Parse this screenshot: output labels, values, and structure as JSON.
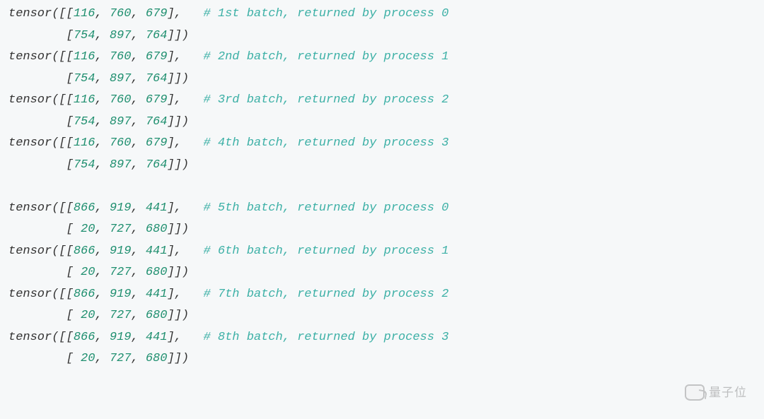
{
  "blocks": [
    {
      "lines": [
        {
          "row": [
            116,
            760,
            679
          ],
          "open": true,
          "close": false,
          "comment": "# 1st batch, returned by process 0"
        },
        {
          "row": [
            754,
            897,
            764
          ],
          "open": false,
          "close": true,
          "comment": null
        },
        {
          "row": [
            116,
            760,
            679
          ],
          "open": true,
          "close": false,
          "comment": "# 2nd batch, returned by process 1"
        },
        {
          "row": [
            754,
            897,
            764
          ],
          "open": false,
          "close": true,
          "comment": null
        },
        {
          "row": [
            116,
            760,
            679
          ],
          "open": true,
          "close": false,
          "comment": "# 3rd batch, returned by process 2"
        },
        {
          "row": [
            754,
            897,
            764
          ],
          "open": false,
          "close": true,
          "comment": null
        },
        {
          "row": [
            116,
            760,
            679
          ],
          "open": true,
          "close": false,
          "comment": "# 4th batch, returned by process 3"
        },
        {
          "row": [
            754,
            897,
            764
          ],
          "open": false,
          "close": true,
          "comment": null
        }
      ]
    },
    {
      "lines": [
        {
          "row": [
            866,
            919,
            441
          ],
          "open": true,
          "close": false,
          "comment": "# 5th batch, returned by process 0"
        },
        {
          "row": [
            20,
            727,
            680
          ],
          "open": false,
          "close": true,
          "comment": null
        },
        {
          "row": [
            866,
            919,
            441
          ],
          "open": true,
          "close": false,
          "comment": "# 6th batch, returned by process 1"
        },
        {
          "row": [
            20,
            727,
            680
          ],
          "open": false,
          "close": true,
          "comment": null
        },
        {
          "row": [
            866,
            919,
            441
          ],
          "open": true,
          "close": false,
          "comment": "# 7th batch, returned by process 2"
        },
        {
          "row": [
            20,
            727,
            680
          ],
          "open": false,
          "close": true,
          "comment": null
        },
        {
          "row": [
            866,
            919,
            441
          ],
          "open": true,
          "close": false,
          "comment": "# 8th batch, returned by process 3"
        },
        {
          "row": [
            20,
            727,
            680
          ],
          "open": false,
          "close": true,
          "comment": null
        }
      ]
    }
  ],
  "watermark": "量子位"
}
